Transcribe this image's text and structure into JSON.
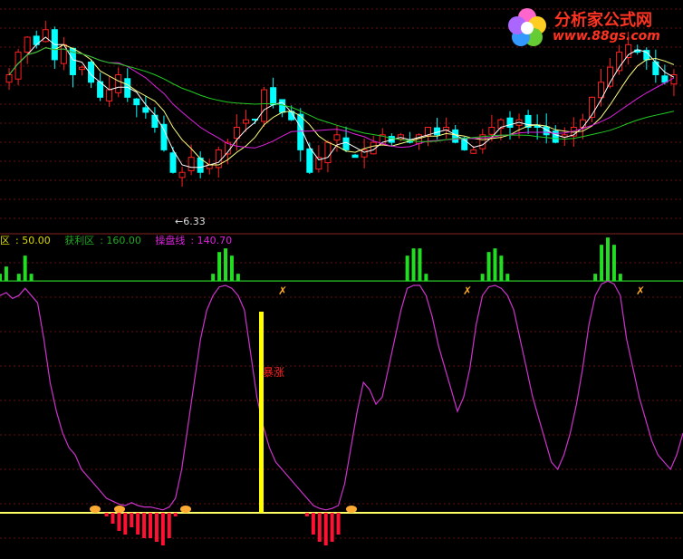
{
  "logo": {
    "title": "分析家公式网",
    "url": "www.88gs.com"
  },
  "main_chart": {
    "low_label": "6.33"
  },
  "indicator": {
    "legend": [
      {
        "label": "区",
        "value": "50.00",
        "color": "#dddd00"
      },
      {
        "label": "获利区",
        "value": "160.00",
        "color": "#22aa22"
      },
      {
        "label": "操盘线",
        "value": "140.70",
        "color": "#dd22dd"
      }
    ],
    "signal_label": "暴涨"
  },
  "colors": {
    "up": "#ff2020",
    "down": "#00ffff",
    "ma5": "#ffffff",
    "ma10": "#ffff80",
    "ma20": "#dd22dd",
    "ma60": "#22cc22",
    "line": "#cc33cc"
  },
  "chart_data": [
    {
      "type": "candlestick",
      "ylim": [
        6.0,
        8.75
      ],
      "annotations": [
        {
          "text": "6.33",
          "at": "low"
        }
      ],
      "close_path": [
        7.9,
        8.2,
        8.4,
        8.3,
        8.5,
        8.1,
        8.3,
        7.9,
        8.0,
        7.8,
        7.6,
        7.7,
        7.9,
        7.6,
        7.5,
        7.4,
        7.2,
        6.9,
        6.6,
        6.6,
        6.8,
        6.6,
        6.7,
        6.9,
        7.0,
        7.2,
        7.3,
        7.3,
        7.7,
        7.5,
        7.4,
        7.3,
        6.9,
        6.6,
        6.8,
        7.0,
        7.1,
        6.9,
        6.8,
        6.9,
        7.0,
        7.1,
        7.0,
        7.1,
        7.0,
        7.1,
        7.2,
        7.1,
        7.2,
        7.0,
        6.9,
        6.9,
        7.1,
        7.2,
        7.3,
        7.2,
        7.3,
        7.2,
        7.2,
        7.1,
        7.0,
        7.1,
        7.2,
        7.3,
        7.6,
        7.8,
        8.0,
        8.2,
        8.3,
        8.2,
        8.1,
        7.9,
        7.8,
        7.9
      ]
    },
    {
      "type": "line",
      "series_values": {
        "trade_line": [
          150,
          152,
          148,
          150,
          155,
          150,
          145,
          120,
          90,
          70,
          55,
          45,
          40,
          30,
          25,
          20,
          15,
          10,
          8,
          6,
          5,
          7,
          5,
          4,
          4,
          3,
          2,
          4,
          10,
          30,
          60,
          90,
          120,
          140,
          150,
          156,
          157,
          155,
          150,
          140,
          110,
          80,
          60,
          45,
          35,
          30,
          25,
          20,
          15,
          10,
          5,
          3,
          2,
          3,
          5,
          20,
          45,
          70,
          90,
          85,
          75,
          80,
          100,
          120,
          140,
          155,
          157,
          157,
          150,
          135,
          115,
          100,
          85,
          70,
          80,
          100,
          130,
          150,
          156,
          157,
          155,
          150,
          140,
          120,
          100,
          80,
          65,
          50,
          35,
          30,
          40,
          55,
          75,
          100,
          130,
          150,
          158,
          160,
          158,
          150,
          120,
          100,
          80,
          65,
          50,
          40,
          35,
          30,
          40,
          55
        ]
      },
      "ylim": [
        0,
        165
      ],
      "reference_lines": [
        50,
        160
      ]
    }
  ]
}
